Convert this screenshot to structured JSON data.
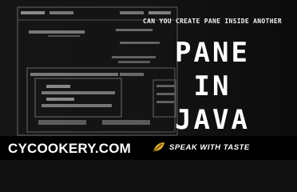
{
  "headline": {
    "kicker": "CAN YOU CREATE PANE INSIDE ANOTHER",
    "line1": "PANE",
    "line2": "IN",
    "line3": "JAVA"
  },
  "footer": {
    "brand": "CYCOOKERY.COM",
    "tagline": "SPEAK WITH TASTE"
  },
  "colors": {
    "background": "#151515",
    "footer": "#000000",
    "text": "#ffffff",
    "accent": "#d8a62a"
  },
  "icons": {
    "footer_mark": "leaf-icon"
  }
}
